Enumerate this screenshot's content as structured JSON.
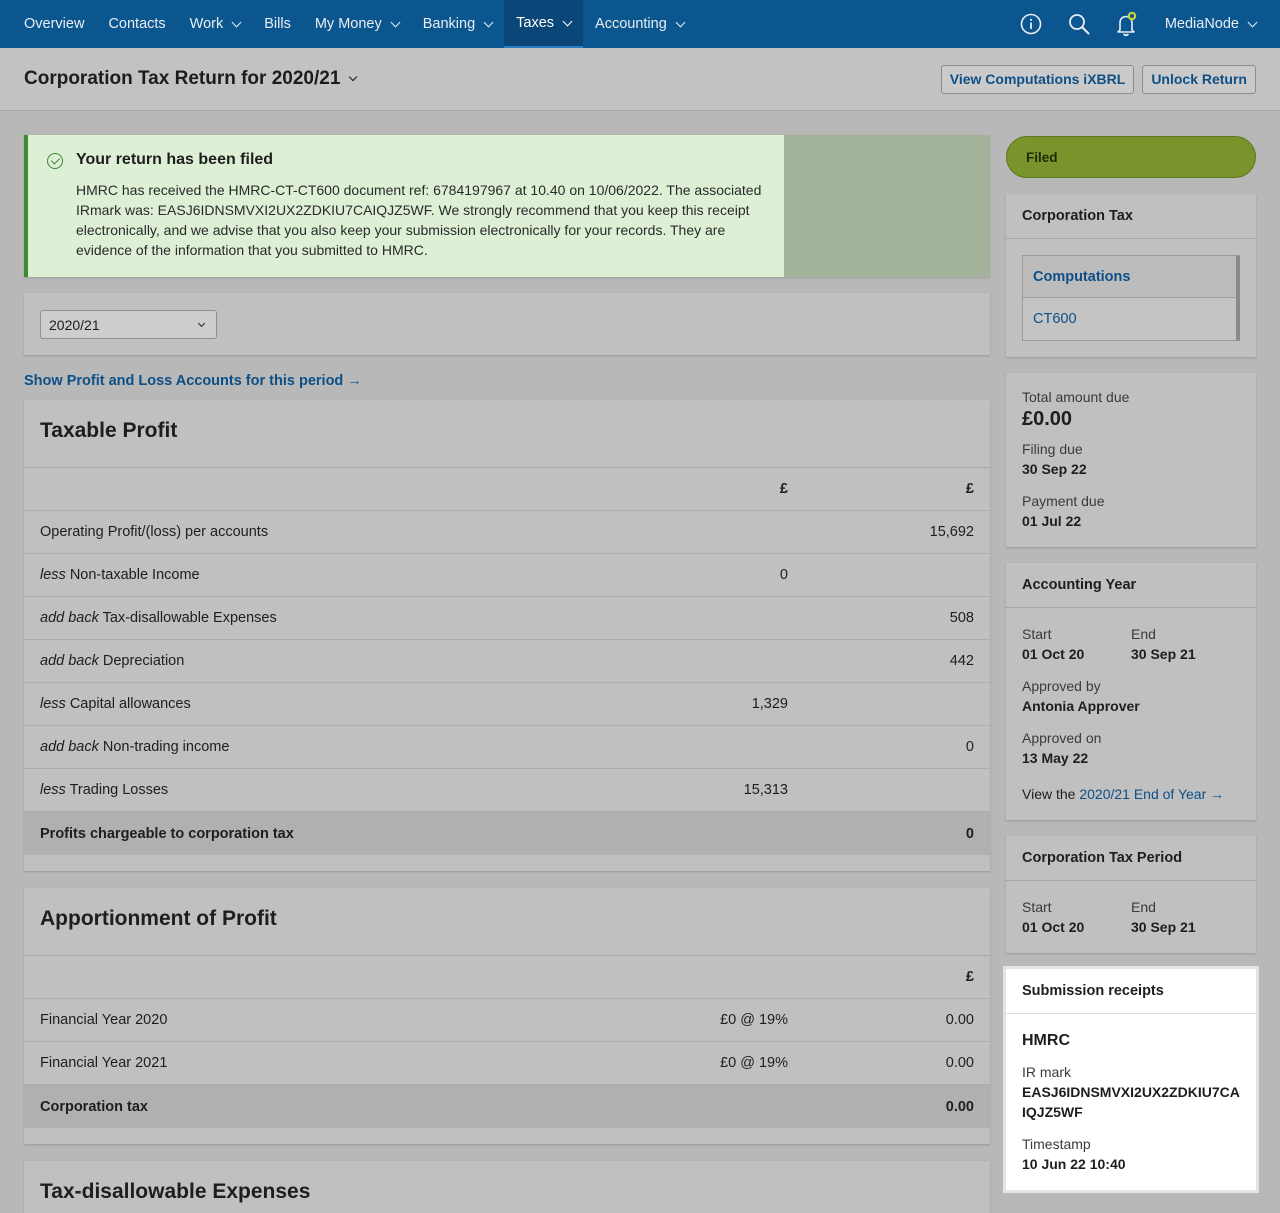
{
  "nav": {
    "items": [
      {
        "label": "Overview",
        "dropdown": false,
        "active": false
      },
      {
        "label": "Contacts",
        "dropdown": false,
        "active": false
      },
      {
        "label": "Work",
        "dropdown": true,
        "active": false
      },
      {
        "label": "Bills",
        "dropdown": false,
        "active": false
      },
      {
        "label": "My Money",
        "dropdown": true,
        "active": false
      },
      {
        "label": "Banking",
        "dropdown": true,
        "active": false
      },
      {
        "label": "Taxes",
        "dropdown": true,
        "active": true
      },
      {
        "label": "Accounting",
        "dropdown": true,
        "active": false
      }
    ],
    "user": "MediaNode",
    "icons": [
      "info-icon",
      "search-icon",
      "bell-icon"
    ]
  },
  "header": {
    "title": "Corporation Tax Return for 2020/21",
    "view_computations": "View Computations iXBRL",
    "unlock": "Unlock Return"
  },
  "banner": {
    "title": "Your return has been filed",
    "text": "HMRC has received the HMRC-CT-CT600 document ref: 6784197967 at 10.40 on 10/06/2022. The associated IRmark was: EASJ6IDNSMVXI2UX2ZDKIU7CAIQJZ5WF. We strongly recommend that you keep this receipt electronically, and we advise that you also keep your submission electronically for your records. They are evidence of the information that you submitted to HMRC."
  },
  "year_select": {
    "value": "2020/21"
  },
  "pl_link": "Show Profit and Loss Accounts for this period →",
  "taxable_profit": {
    "title": "Taxable Profit",
    "col1": "£",
    "col2": "£",
    "rows": [
      {
        "prefix": "",
        "label": "Operating Profit/(loss) per accounts",
        "c1": "",
        "c2": "15,692"
      },
      {
        "prefix": "less",
        "label": "Non-taxable Income",
        "c1": "0",
        "c2": ""
      },
      {
        "prefix": "add back",
        "label": "Tax-disallowable Expenses",
        "c1": "",
        "c2": "508"
      },
      {
        "prefix": "add back",
        "label": "Depreciation",
        "c1": "",
        "c2": "442"
      },
      {
        "prefix": "less",
        "label": "Capital allowances",
        "c1": "1,329",
        "c2": ""
      },
      {
        "prefix": "add back",
        "label": "Non-trading income",
        "c1": "",
        "c2": "0"
      },
      {
        "prefix": "less",
        "label": "Trading Losses",
        "c1": "15,313",
        "c2": ""
      }
    ],
    "total": {
      "label": "Profits chargeable to corporation tax",
      "value": "0"
    }
  },
  "apportionment": {
    "title": "Apportionment of Profit",
    "col2": "£",
    "rows": [
      {
        "label": "Financial Year 2020",
        "c1": "£0 @ 19%",
        "c2": "0.00"
      },
      {
        "label": "Financial Year 2021",
        "c1": "£0 @ 19%",
        "c2": "0.00"
      }
    ],
    "total": {
      "label": "Corporation tax",
      "value": "0.00"
    }
  },
  "disallowable": {
    "title": "Tax-disallowable Expenses"
  },
  "sidebar": {
    "status": "Filed",
    "corp_tax": {
      "title": "Corporation Tax",
      "links": [
        "Computations",
        "CT600"
      ]
    },
    "amounts": {
      "total_label": "Total amount due",
      "total_value": "£0.00",
      "filing_label": "Filing due",
      "filing_value": "30 Sep 22",
      "payment_label": "Payment due",
      "payment_value": "01 Jul 22"
    },
    "accounting_year": {
      "title": "Accounting Year",
      "start_label": "Start",
      "start_value": "01 Oct 20",
      "end_label": "End",
      "end_value": "30 Sep 21",
      "approved_by_label": "Approved by",
      "approved_by_value": "Antonia Approver",
      "approved_on_label": "Approved on",
      "approved_on_value": "13 May 22",
      "view_prefix": "View the",
      "view_link": "2020/21 End of Year →"
    },
    "tax_period": {
      "title": "Corporation Tax Period",
      "start_label": "Start",
      "start_value": "01 Oct 20",
      "end_label": "End",
      "end_value": "30 Sep 21"
    },
    "receipts": {
      "title": "Submission receipts",
      "authority": "HMRC",
      "irmark_label": "IR mark",
      "irmark_value": "EASJ6IDNSMVXI2UX2ZDKIU7CAIQJZ5WF",
      "timestamp_label": "Timestamp",
      "timestamp_value": "10 Jun 22 10:40"
    }
  },
  "colors": {
    "nav_bg": "#0b568e",
    "link": "#0d4f86",
    "filed_green": "#78942a",
    "success_bg": "#ddf0d5",
    "success_border": "#3c8a32"
  }
}
